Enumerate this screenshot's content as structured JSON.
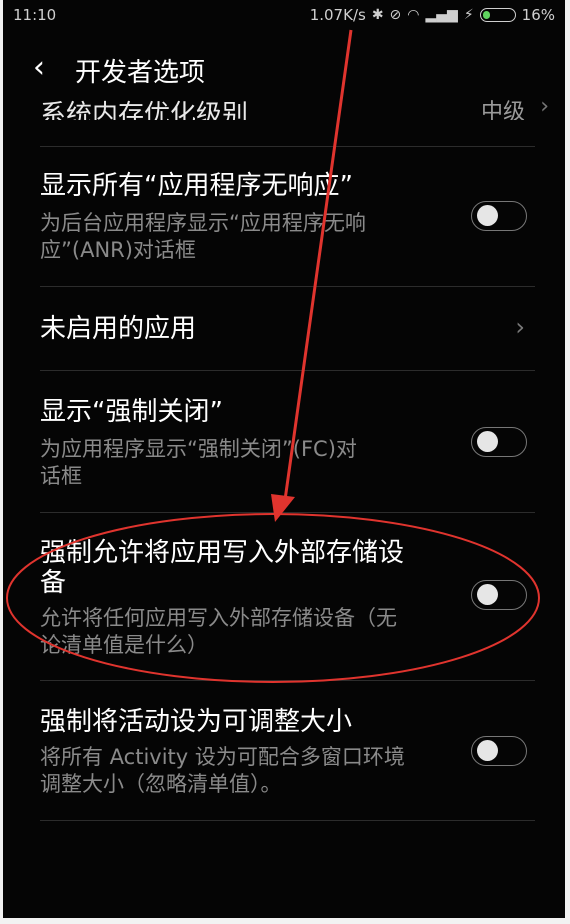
{
  "status_bar": {
    "time": "11:10",
    "speed": "1.07K/s",
    "battery_percent": "16%",
    "battery_level": 0.16,
    "icons": [
      "bluetooth-icon",
      "alarm-off-icon",
      "wifi-icon",
      "signal-icon",
      "charging-icon",
      "battery-icon"
    ]
  },
  "header": {
    "title": "开发者选项",
    "back_icon": "chevron-left-icon"
  },
  "partial_row": {
    "label": "系统内存优化级别",
    "value": "中级"
  },
  "settings": [
    {
      "title": "显示所有“应用程序无响应”",
      "desc_line1": "为后台应用程序显示“应用程序无响",
      "desc_line2": "应”(ANR)对话框",
      "control": "toggle",
      "enabled": false
    },
    {
      "title": "未启用的应用",
      "control": "chevron"
    },
    {
      "title": "显示“强制关闭”",
      "desc_line1": "为应用程序显示“强制关闭”(FC)对",
      "desc_line2": "话框",
      "control": "toggle",
      "enabled": false
    },
    {
      "title_line1": "强制允许将应用写入外部存储设",
      "title_line2": "备",
      "desc_line1": "允许将任何应用写入外部存储设备（无",
      "desc_line2": "论清单值是什么）",
      "control": "toggle",
      "enabled": false,
      "highlighted": true
    },
    {
      "title": "强制将活动设为可调整大小",
      "desc_line1": "将所有 Activity 设为可配合多窗口环境",
      "desc_line2": "调整大小（忽略清单值）。",
      "control": "toggle",
      "enabled": false
    }
  ],
  "annotation": {
    "color": "#e0342e"
  }
}
